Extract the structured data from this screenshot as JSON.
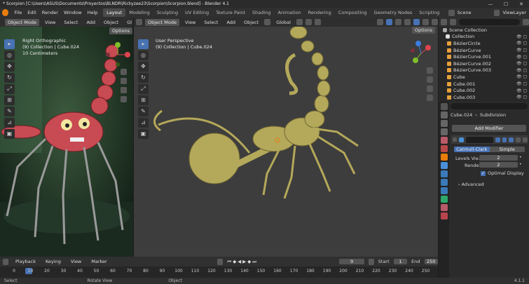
{
  "window": {
    "title": "* Scorpion [C:\\Users\\ASUS\\Documents\\Proyectos\\BLNDR\\Rickyzee23\\Scorpion\\Scorpion.blend] - Blender 4.1",
    "min": "—",
    "max": "☐",
    "close": "✕"
  },
  "menu": [
    "File",
    "Edit",
    "Render",
    "Window",
    "Help"
  ],
  "workspaces": [
    "Layout",
    "Modeling",
    "Sculpting",
    "UV Editing",
    "Texture Paint",
    "Shading",
    "Animation",
    "Rendering",
    "Compositing",
    "Geometry Nodes",
    "Scripting"
  ],
  "scene": "Scene",
  "view_layer": "ViewLayer",
  "left_vp": {
    "mode": "Object Mode",
    "menus": [
      "View",
      "Select",
      "Add",
      "Object"
    ],
    "extra": "Gl",
    "options": "Options",
    "info_title": "Right Orthographic",
    "info_coll": "(9) Collection | Cube.024",
    "info_scale": "10 Centimeters"
  },
  "main_vp": {
    "mode": "Object Mode",
    "menus": [
      "View",
      "Select",
      "Add",
      "Object"
    ],
    "orient": "Global",
    "options": "Options",
    "info_title": "User Perspective",
    "info_coll": "(9) Collection | Cube.024"
  },
  "outliner": {
    "search_placeholder": "",
    "scene_coll": "Scene Collection",
    "collection": "Collection",
    "items": [
      "BézierCircle",
      "BézierCurve",
      "BézierCurve.001",
      "BézierCurve.002",
      "BézierCurve.003",
      "Cube",
      "Cube.001",
      "Cube.002",
      "Cube.003"
    ]
  },
  "props": {
    "object": "Cube.024",
    "modifier_name": "Subdivision",
    "add_modifier": "Add Modifier",
    "tab_a": "Catmull-Clark",
    "tab_b": "Simple",
    "levels_label": "Levels Vie...",
    "levels_val": "2",
    "render_label": "Render",
    "render_val": "2",
    "optimal": "Optimal Display",
    "advanced": "Advanced"
  },
  "timeline": {
    "menus": [
      "Playback",
      "Keying",
      "View",
      "Marker"
    ],
    "current": "9",
    "start_label": "Start",
    "start": "1",
    "end_label": "End",
    "end": "250",
    "ticks": [
      "0",
      "10",
      "20",
      "30",
      "40",
      "50",
      "60",
      "70",
      "80",
      "90",
      "100",
      "110",
      "120",
      "130",
      "140",
      "150",
      "160",
      "170",
      "180",
      "190",
      "200",
      "210",
      "220",
      "230",
      "240",
      "250"
    ],
    "current_tick": "9"
  },
  "status": {
    "select": "Select",
    "rotate": "Rotate View",
    "object": "Object",
    "version": "4.1.1"
  },
  "colors": {
    "accent": "#4772b3",
    "orange": "#e87d0d",
    "model": "#b4a85a"
  }
}
